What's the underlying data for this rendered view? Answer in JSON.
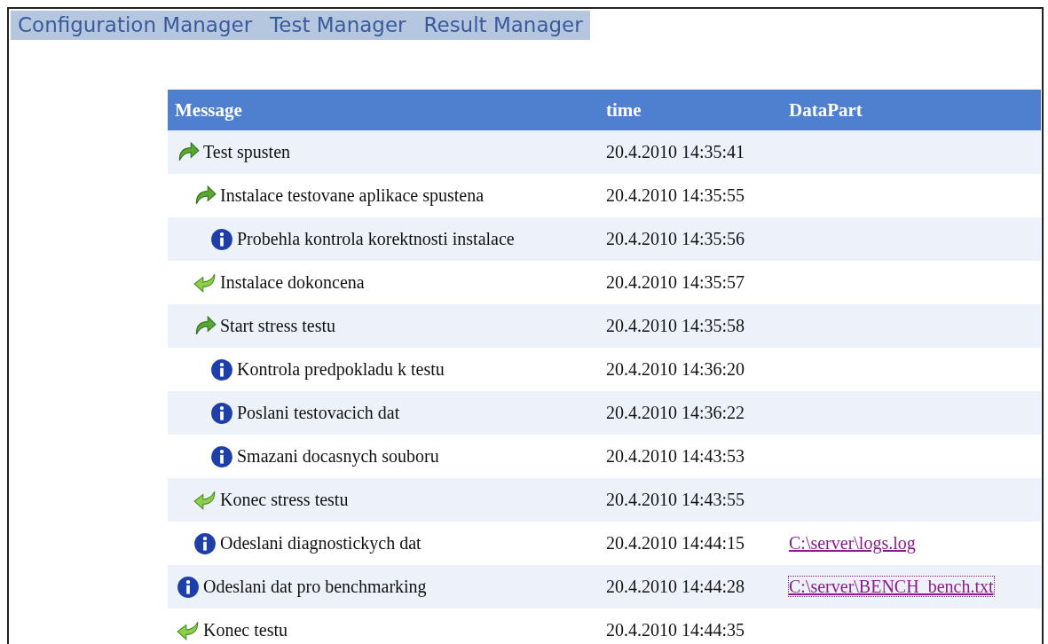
{
  "menu": [
    {
      "label": "Configuration Manager"
    },
    {
      "label": "Test Manager"
    },
    {
      "label": "Result Manager"
    }
  ],
  "table": {
    "columns": [
      "Message",
      "time",
      "DataPart"
    ],
    "rows": [
      {
        "kind": "start",
        "message": "Test spusten",
        "time": "20.4.2010 14:35:41",
        "children": [
          {
            "kind": "start",
            "message": "Instalace testovane aplikace spustena",
            "time": "20.4.2010 14:35:55",
            "children": [
              {
                "kind": "info",
                "message": "Probehla kontrola korektnosti instalace",
                "time": "20.4.2010 14:35:56"
              }
            ]
          },
          {
            "kind": "end",
            "message": "Instalace dokoncena",
            "time": "20.4.2010 14:35:57"
          },
          {
            "kind": "start",
            "message": "Start stress testu",
            "time": "20.4.2010 14:35:58",
            "children": [
              {
                "kind": "info",
                "message": "Kontrola predpokladu k testu",
                "time": "20.4.2010 14:36:20"
              },
              {
                "kind": "info",
                "message": "Poslani testovacich dat",
                "time": "20.4.2010 14:36:22"
              },
              {
                "kind": "info",
                "message": "Smazani docasnych souboru",
                "time": "20.4.2010 14:43:53"
              }
            ]
          },
          {
            "kind": "end",
            "message": "Konec stress testu",
            "time": "20.4.2010 14:43:55"
          },
          {
            "kind": "info",
            "message": "Odeslani diagnostickych dat",
            "time": "20.4.2010 14:44:15",
            "data_link": {
              "label": "C:\\server\\logs.log",
              "focused": false
            }
          }
        ]
      },
      {
        "kind": "info",
        "message": "Odeslani dat pro benchmarking",
        "time": "20.4.2010 14:44:28",
        "data_link": {
          "label": "C:\\server\\BENCH_bench.txt",
          "focused": true
        }
      },
      {
        "kind": "end",
        "message": "Konec testu",
        "time": "20.4.2010 14:44:35"
      }
    ]
  }
}
